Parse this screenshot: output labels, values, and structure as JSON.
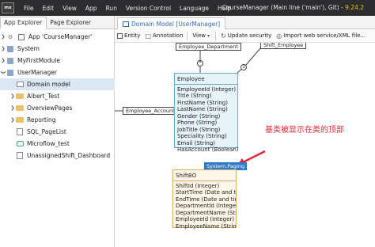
{
  "menubar": {
    "logo": "mx",
    "items": [
      "File",
      "Edit",
      "View",
      "App",
      "Run",
      "Version Control",
      "Language",
      "Help"
    ],
    "title_prefix": "CourseManager (Main line ('main'), Git) - ",
    "version": "9.24.2"
  },
  "left_panel": {
    "tabs": [
      "App Explorer",
      "Page Explorer"
    ],
    "tree": [
      {
        "label": "App 'CourseManager'",
        "icon": "box-icon",
        "chevron": "right"
      },
      {
        "label": "System",
        "icon": "puzzle-icon",
        "chevron": "right"
      },
      {
        "label": "MyFirstModule",
        "icon": "puzzle-icon",
        "chevron": "right"
      },
      {
        "label": "UserManager",
        "icon": "puzzle-icon",
        "chevron": "down"
      },
      {
        "label": "Domain model",
        "icon": "domain-model-icon",
        "chevron": ""
      },
      {
        "label": "Albert_Test",
        "icon": "folder-icon",
        "chevron": "right"
      },
      {
        "label": "OverviewPages",
        "icon": "folder-icon",
        "chevron": "right"
      },
      {
        "label": "Reporting",
        "icon": "folder-icon",
        "chevron": "right"
      },
      {
        "label": "SQL_PageList",
        "icon": "page-icon",
        "chevron": ""
      },
      {
        "label": "Microflow_test",
        "icon": "microflow-icon",
        "chevron": ""
      },
      {
        "label": "UnassignedShift_Dashboard",
        "icon": "page-icon",
        "chevron": ""
      }
    ]
  },
  "doc_tab": {
    "label": "Domain Model [UserManager]"
  },
  "toolbar": {
    "entity": "Entity",
    "annotation": "Annotation",
    "view": "View",
    "update_security": "Update security",
    "import": "Import web service/XML file..."
  },
  "diagram": {
    "employee": {
      "name": "Employee",
      "attributes": [
        "EmployeeId (Integer)",
        "Title (String)",
        "FirstName (String)",
        "LastName (String)",
        "Gender (String)",
        "Phone (String)",
        "JobTitle (String)",
        "Speciality (String)",
        "Email (String)",
        "HasAccount (Boolean)"
      ]
    },
    "shiftbo": {
      "name": "ShiftBO",
      "generalization": "System.Paging",
      "attributes": [
        "ShiftId (Integer)",
        "StartTime (Date and time)",
        "EndTime (Date and time)",
        "DepartmentId (Integer)",
        "DepartmentName (String)",
        "EmployeeId (Integer)",
        "EmployeeName (String)"
      ]
    },
    "associations": {
      "employee_department": "Employee_Department",
      "shift_employee": "Shift_Employee",
      "employee_account": "Employee_Account"
    },
    "multiplicity_star": "*",
    "multiplicity_one": "1"
  },
  "annotation_text": "基类被显示在类的顶部",
  "colors": {
    "annotation": "#e0293b",
    "entity_border": "#6aaad0",
    "badge": "#2d79c7"
  }
}
